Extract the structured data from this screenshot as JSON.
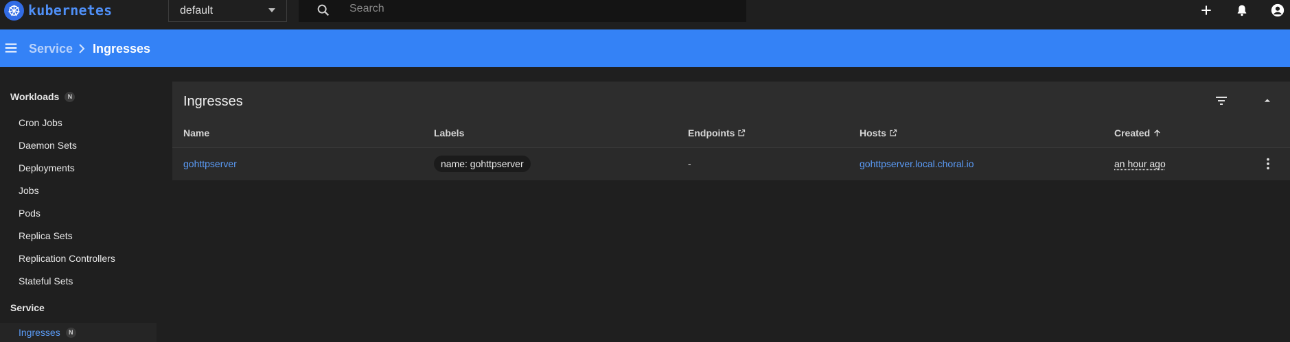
{
  "app": {
    "wordmark": "kubernetes"
  },
  "namespace": {
    "selected": "default"
  },
  "search": {
    "placeholder": "Search"
  },
  "breadcrumb": {
    "parent": "Service",
    "current": "Ingresses"
  },
  "sidebar": {
    "workloads_label": "Workloads",
    "workloads_badge": "N",
    "workload_items": [
      "Cron Jobs",
      "Daemon Sets",
      "Deployments",
      "Jobs",
      "Pods",
      "Replica Sets",
      "Replication Controllers",
      "Stateful Sets"
    ],
    "service_label": "Service",
    "service_items": [
      {
        "label": "Ingresses",
        "badge": "N",
        "active": true
      }
    ]
  },
  "card": {
    "title": "Ingresses",
    "columns": {
      "name": "Name",
      "labels": "Labels",
      "endpoints": "Endpoints",
      "hosts": "Hosts",
      "created": "Created"
    },
    "rows": [
      {
        "name": "gohttpserver",
        "label_chip": "name: gohttpserver",
        "endpoints": "-",
        "hosts": "gohttpserver.local.choral.io",
        "created": "an hour ago"
      }
    ]
  },
  "colors": {
    "accent": "#3482f6",
    "link": "#5b9cf8",
    "background": "#1f1f1f",
    "card": "#2d2d2d"
  },
  "icons": [
    "kubernetes-logo",
    "search-icon",
    "plus-icon",
    "bell-icon",
    "account-icon",
    "menu-icon",
    "chevron-right-icon",
    "filter-icon",
    "collapse-icon",
    "external-link-icon",
    "sort-arrow-up-icon",
    "more-vert-icon"
  ]
}
